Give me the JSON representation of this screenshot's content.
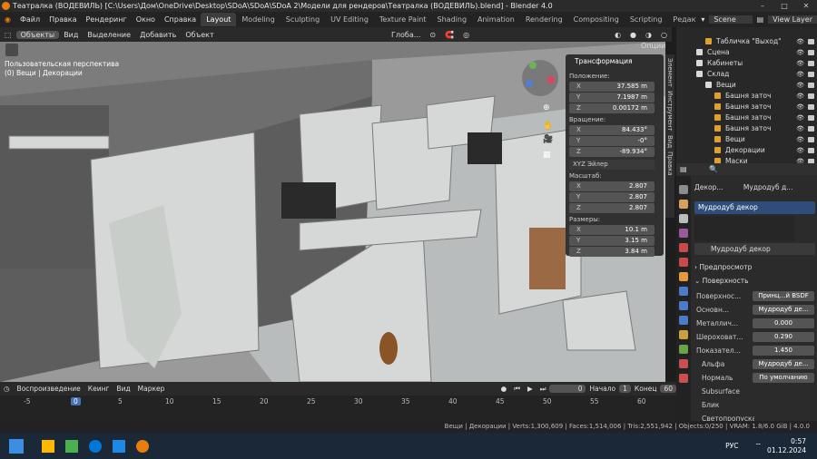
{
  "window": {
    "title": "Театралка (ВОДЕВИЛЬ) [C:\\Users\\Дом\\OneDrive\\Desktop\\SDoA\\SDoA\\SDoA 2\\Модели для рендеров\\Театралка (ВОДЕВИЛЬ).blend] - Blender 4.0"
  },
  "menu": [
    "Файл",
    "Правка",
    "Рендеринг",
    "Окно",
    "Справка"
  ],
  "workspaces": [
    "Layout",
    "Modeling",
    "Sculpting",
    "UV Editing",
    "Texture Paint",
    "Shading",
    "Animation",
    "Rendering",
    "Compositing",
    "Scripting",
    "Редактирование"
  ],
  "scene": {
    "label": "Scene",
    "view_layer": "View Layer"
  },
  "viewport_header": {
    "mode": "Объекты",
    "items": [
      "Вид",
      "Выделение",
      "Добавить",
      "Объект"
    ],
    "transform": "Глоба...",
    "options": "Опции"
  },
  "viewport": {
    "perspective": "Пользовательская перспектива",
    "collection": "(0) Вещи | Декорации"
  },
  "npanel": {
    "title": "Трансформация",
    "location_label": "Положение:",
    "location": [
      [
        "X",
        "37.585 m"
      ],
      [
        "Y",
        "7.1987 m"
      ],
      [
        "Z",
        "0.00172 m"
      ]
    ],
    "rotation_label": "Вращение:",
    "rotation": [
      [
        "X",
        "84.433°"
      ],
      [
        "Y",
        "-0°"
      ],
      [
        "Z",
        "-89.934°"
      ]
    ],
    "euler": "XYZ Эйлер",
    "scale_label": "Масштаб:",
    "scale": [
      [
        "X",
        "2.807"
      ],
      [
        "Y",
        "2.807"
      ],
      [
        "Z",
        "2.807"
      ]
    ],
    "dims_label": "Размеры:",
    "dims": [
      [
        "X",
        "10.1 m"
      ],
      [
        "Y",
        "3.15 m"
      ],
      [
        "Z",
        "3.84 m"
      ]
    ]
  },
  "side_tabs": [
    "Элемент",
    "Инструмент",
    "Вид",
    "Правка"
  ],
  "outliner": [
    {
      "name": "Табличка \"Выход\"",
      "indent": 2,
      "color": "#e0a030"
    },
    {
      "name": "Сцена",
      "indent": 1,
      "color": "#d9d9d9"
    },
    {
      "name": "Кабинеты",
      "indent": 1,
      "color": "#d9d9d9"
    },
    {
      "name": "Склад",
      "indent": 1,
      "color": "#d9d9d9"
    },
    {
      "name": "Вещи",
      "indent": 2,
      "color": "#d9d9d9"
    },
    {
      "name": "Башня заточ",
      "indent": 3,
      "color": "#e0a030"
    },
    {
      "name": "Башня заточ",
      "indent": 3,
      "color": "#e0a030"
    },
    {
      "name": "Башня заточ",
      "indent": 3,
      "color": "#e0a030"
    },
    {
      "name": "Башня заточ",
      "indent": 3,
      "color": "#e0a030"
    },
    {
      "name": "Вещи",
      "indent": 3,
      "color": "#e0a030"
    },
    {
      "name": "Декорации",
      "indent": 3,
      "color": "#e0a030"
    },
    {
      "name": "Маски",
      "indent": 3,
      "color": "#e0a030"
    }
  ],
  "properties": {
    "breadcrumb_a": "Декор...",
    "breadcrumb_b": "Мудродуб д...",
    "slot": "Мудродуб декор",
    "material": "Мудродуб декор",
    "preview": "Предпросмотр",
    "surface_panel": "Поверхность",
    "rows": [
      {
        "label": "Поверхнос...",
        "value": "Принц...й BSDF"
      },
      {
        "label": "Основн...",
        "value": "Мудродуб де..."
      },
      {
        "label": "Металлич...",
        "value": "0.000"
      },
      {
        "label": "Шероховат...",
        "value": "0.290"
      },
      {
        "label": "Показател...",
        "value": "1.450"
      },
      {
        "label": "Альфа",
        "value": "Мудродуб де..."
      },
      {
        "label": "Нормаль",
        "value": "По умолчанию"
      },
      {
        "label": "Subsurface",
        "value": ""
      },
      {
        "label": "Блик",
        "value": ""
      },
      {
        "label": "Светопропускаемость",
        "value": ""
      }
    ]
  },
  "timeline": {
    "items": [
      "Воспроизведение",
      "Кеинг",
      "Вид",
      "Маркер"
    ],
    "current": "0",
    "start_label": "Начало",
    "start": "1",
    "end_label": "Конец",
    "end": "60",
    "ticks": [
      "-5",
      "0",
      "5",
      "10",
      "15",
      "20",
      "25",
      "30",
      "35",
      "40",
      "45",
      "50",
      "55",
      "60"
    ]
  },
  "status_bar": "Вещи | Декорации | Verts:1,300,609 | Faces:1,514,006 | Tris:2,551,942 | Objects:0/250 | VRAM: 1.8/6.0 GiB | 4.0.0",
  "taskbar": {
    "lang": "РУС",
    "time": "0:57",
    "date": "01.12.2024"
  }
}
